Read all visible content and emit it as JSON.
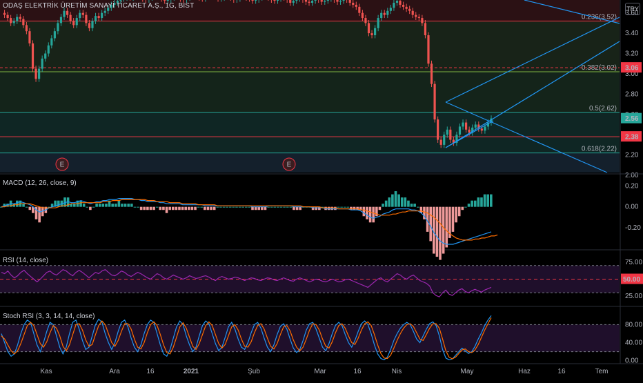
{
  "header": {
    "title": "ODAŞ ELEKTRİK ÜRETİM SANAYİ TİCARET A.Ş., 1G, BIST",
    "currency": "TRY"
  },
  "indicators": {
    "macd": "MACD (12, 26, close, 9)",
    "rsi": "RSI (14, close)",
    "stoch": "Stoch RSI (3, 3, 14, 14, close)"
  },
  "price_axis": {
    "ticks": [
      "3.60",
      "3.40",
      "3.20",
      "3.00",
      "2.80",
      "2.60",
      "2.40",
      "2.20",
      "2.00"
    ],
    "markers": [
      {
        "label": "3.06",
        "color": "#f23645"
      },
      {
        "label": "2.56",
        "color": "#26a69a"
      },
      {
        "label": "2.38",
        "color": "#f23645"
      }
    ]
  },
  "macd_axis": {
    "ticks": [
      "0.20",
      "0.00",
      "-0.20"
    ]
  },
  "rsi_axis": {
    "ticks": [
      "75.00",
      "25.00"
    ],
    "marker": "50.00"
  },
  "stoch_axis": {
    "ticks": [
      "80.00",
      "40.00",
      "0.00"
    ]
  },
  "time_axis": {
    "ticks": [
      "Kas",
      "Ara",
      "16",
      "2021",
      "Şub",
      "Mar",
      "16",
      "Nis",
      "May",
      "Haz",
      "16",
      "Tem"
    ]
  },
  "fib_levels": [
    {
      "label": "0.236(3.52)",
      "value": 3.52
    },
    {
      "label": "0.382(3.02)",
      "value": 3.02
    },
    {
      "label": "0.5(2.62)",
      "value": 2.62
    },
    {
      "label": "0.618(2.22)",
      "value": 2.22
    }
  ],
  "earnings": [
    "E",
    "E"
  ],
  "chart_data": {
    "type": "candlestick",
    "ylim": [
      2.0,
      3.7
    ],
    "horizontal_lines": [
      3.06,
      2.38
    ],
    "price_series": [
      3.6,
      3.58,
      3.55,
      3.5,
      3.52,
      3.56,
      3.54,
      3.48,
      3.42,
      3.3,
      3.05,
      2.95,
      3.05,
      3.15,
      3.2,
      3.28,
      3.35,
      3.42,
      3.5,
      3.56,
      3.62,
      3.58,
      3.52,
      3.48,
      3.55,
      3.6,
      3.58,
      3.5,
      3.45,
      3.52,
      3.57,
      3.55,
      3.6,
      3.62,
      3.65,
      3.68,
      3.7,
      3.72,
      3.74,
      3.75,
      3.76,
      3.75,
      3.77,
      3.78,
      3.76,
      3.74,
      3.73,
      3.75,
      3.77,
      3.78,
      3.76,
      3.74,
      3.72,
      3.73,
      3.75,
      3.77,
      3.76,
      3.74,
      3.73,
      3.75,
      3.76,
      3.78,
      3.77,
      3.75,
      3.74,
      3.76,
      3.77,
      3.78,
      3.76,
      3.74,
      3.75,
      3.77,
      3.76,
      3.75,
      3.73,
      3.74,
      3.76,
      3.77,
      3.75,
      3.74,
      3.72,
      3.73,
      3.75,
      3.76,
      3.77,
      3.75,
      3.73,
      3.72,
      3.74,
      3.76,
      3.75,
      3.73,
      3.7,
      3.72,
      3.74,
      3.75,
      3.73,
      3.71,
      3.7,
      3.72,
      3.74,
      3.73,
      3.71,
      3.72,
      3.74,
      3.75,
      3.73,
      3.71,
      3.72,
      3.74,
      3.73,
      3.7,
      3.68,
      3.66,
      3.6,
      3.55,
      3.5,
      3.4,
      3.38,
      3.45,
      3.55,
      3.6,
      3.58,
      3.62,
      3.65,
      3.7,
      3.72,
      3.68,
      3.66,
      3.64,
      3.62,
      3.58,
      3.56,
      3.55,
      3.5,
      3.38,
      3.1,
      2.9,
      2.55,
      2.35,
      2.3,
      2.4,
      2.45,
      2.35,
      2.32,
      2.4,
      2.48,
      2.52,
      2.45,
      2.42,
      2.47,
      2.5,
      2.46,
      2.44,
      2.48,
      2.52,
      2.56
    ],
    "macd_series": [
      0.0,
      0.01,
      0.02,
      0.03,
      0.03,
      0.04,
      0.05,
      0.04,
      0.03,
      0.02,
      0.0,
      -0.03,
      -0.05,
      -0.04,
      -0.03,
      -0.01,
      0.0,
      0.01,
      0.02,
      0.03,
      0.04,
      0.05,
      0.04,
      0.04,
      0.05,
      0.06,
      0.05,
      0.04,
      0.03,
      0.04,
      0.05,
      0.05,
      0.06,
      0.06,
      0.07,
      0.07,
      0.07,
      0.08,
      0.08,
      0.08,
      0.08,
      0.08,
      0.07,
      0.07,
      0.06,
      0.06,
      0.05,
      0.05,
      0.05,
      0.05,
      0.04,
      0.04,
      0.03,
      0.03,
      0.03,
      0.03,
      0.03,
      0.02,
      0.02,
      0.02,
      0.02,
      0.02,
      0.02,
      0.02,
      0.01,
      0.01,
      0.01,
      0.01,
      0.01,
      0.01,
      0.01,
      0.01,
      0.01,
      0.01,
      0.01,
      0.01,
      0.01,
      0.01,
      0.01,
      0.0,
      0.0,
      0.0,
      0.0,
      0.0,
      0.01,
      0.01,
      0.01,
      0.01,
      0.01,
      0.01,
      0.01,
      0.01,
      0.0,
      0.0,
      0.0,
      0.0,
      0.0,
      0.0,
      -0.01,
      -0.01,
      -0.01,
      -0.01,
      -0.02,
      -0.02,
      -0.02,
      -0.02,
      -0.02,
      -0.02,
      -0.02,
      -0.02,
      -0.03,
      -0.03,
      -0.03,
      -0.04,
      -0.06,
      -0.08,
      -0.1,
      -0.11,
      -0.1,
      -0.09,
      -0.07,
      -0.06,
      -0.05,
      -0.03,
      -0.02,
      -0.02,
      -0.02,
      -0.02,
      -0.02,
      -0.03,
      -0.03,
      -0.04,
      -0.06,
      -0.09,
      -0.14,
      -0.19,
      -0.25,
      -0.29,
      -0.33,
      -0.35,
      -0.36,
      -0.36,
      -0.36,
      -0.35,
      -0.34,
      -0.33,
      -0.32,
      -0.31,
      -0.3,
      -0.29,
      -0.28,
      -0.27,
      -0.26,
      -0.25,
      -0.24
    ],
    "signal_series": [
      0.0,
      0.0,
      0.01,
      0.01,
      0.02,
      0.02,
      0.03,
      0.03,
      0.03,
      0.03,
      0.02,
      0.01,
      0.0,
      -0.01,
      -0.01,
      -0.01,
      -0.01,
      -0.01,
      0.0,
      0.01,
      0.01,
      0.02,
      0.03,
      0.03,
      0.03,
      0.04,
      0.04,
      0.04,
      0.04,
      0.04,
      0.04,
      0.04,
      0.05,
      0.05,
      0.05,
      0.06,
      0.06,
      0.06,
      0.07,
      0.07,
      0.07,
      0.07,
      0.07,
      0.07,
      0.07,
      0.07,
      0.06,
      0.06,
      0.06,
      0.05,
      0.05,
      0.05,
      0.05,
      0.04,
      0.04,
      0.04,
      0.04,
      0.03,
      0.03,
      0.03,
      0.03,
      0.03,
      0.02,
      0.02,
      0.02,
      0.02,
      0.02,
      0.02,
      0.01,
      0.01,
      0.01,
      0.01,
      0.01,
      0.01,
      0.01,
      0.01,
      0.01,
      0.01,
      0.01,
      0.01,
      0.01,
      0.01,
      0.01,
      0.01,
      0.01,
      0.01,
      0.01,
      0.01,
      0.01,
      0.01,
      0.01,
      0.01,
      0.01,
      0.01,
      0.01,
      0.0,
      0.0,
      0.0,
      0.0,
      0.0,
      0.0,
      -0.01,
      -0.01,
      -0.01,
      -0.01,
      -0.01,
      -0.02,
      -0.02,
      -0.02,
      -0.02,
      -0.02,
      -0.02,
      -0.02,
      -0.03,
      -0.03,
      -0.04,
      -0.05,
      -0.06,
      -0.07,
      -0.08,
      -0.08,
      -0.08,
      -0.08,
      -0.07,
      -0.07,
      -0.06,
      -0.05,
      -0.05,
      -0.04,
      -0.04,
      -0.04,
      -0.04,
      -0.04,
      -0.05,
      -0.06,
      -0.08,
      -0.1,
      -0.13,
      -0.16,
      -0.2,
      -0.23,
      -0.26,
      -0.28,
      -0.3,
      -0.31,
      -0.32,
      -0.32,
      -0.32,
      -0.32,
      -0.31,
      -0.31,
      -0.3,
      -0.3,
      -0.29,
      -0.28,
      -0.28,
      -0.27
    ],
    "rsi_series": [
      60,
      58,
      62,
      56,
      52,
      55,
      60,
      63,
      58,
      54,
      50,
      46,
      50,
      55,
      60,
      62,
      58,
      56,
      60,
      64,
      62,
      58,
      55,
      60,
      63,
      60,
      56,
      52,
      56,
      60,
      58,
      62,
      64,
      60,
      56,
      55,
      58,
      62,
      60,
      56,
      54,
      57,
      60,
      58,
      55,
      52,
      50,
      54,
      58,
      56,
      52,
      50,
      53,
      56,
      54,
      52,
      50,
      52,
      55,
      53,
      51,
      52,
      54,
      55,
      53,
      50,
      48,
      52,
      54,
      52,
      50,
      51,
      53,
      52,
      50,
      48,
      50,
      52,
      51,
      49,
      48,
      50,
      52,
      51,
      49,
      48,
      50,
      52,
      50,
      48,
      47,
      50,
      52,
      50,
      48,
      46,
      48,
      50,
      49,
      47,
      46,
      48,
      50,
      48,
      46,
      47,
      49,
      50,
      48,
      46,
      44,
      42,
      40,
      38,
      42,
      46,
      50,
      52,
      48,
      46,
      50,
      54,
      58,
      56,
      52,
      50,
      54,
      56,
      52,
      48,
      46,
      44,
      40,
      30,
      26,
      24,
      30,
      34,
      28,
      26,
      30,
      34,
      36,
      32,
      30,
      33,
      35,
      33,
      31,
      34,
      36,
      38
    ],
    "stoch_k_series": [
      60,
      40,
      20,
      10,
      15,
      35,
      60,
      80,
      90,
      85,
      60,
      35,
      20,
      40,
      65,
      85,
      80,
      55,
      30,
      15,
      30,
      60,
      85,
      90,
      70,
      45,
      25,
      30,
      55,
      80,
      92,
      85,
      60,
      40,
      25,
      40,
      65,
      85,
      90,
      75,
      50,
      30,
      20,
      35,
      60,
      80,
      90,
      85,
      60,
      35,
      15,
      10,
      25,
      50,
      75,
      88,
      80,
      55,
      35,
      20,
      30,
      55,
      78,
      88,
      82,
      60,
      38,
      22,
      30,
      52,
      75,
      85,
      70,
      48,
      30,
      25,
      40,
      62,
      80,
      85,
      72,
      50,
      30,
      20,
      35,
      58,
      76,
      82,
      70,
      48,
      28,
      18,
      25,
      45,
      68,
      82,
      85,
      70,
      50,
      30,
      22,
      38,
      60,
      78,
      85,
      78,
      58,
      40,
      30,
      45,
      65,
      82,
      88,
      80,
      60,
      35,
      15,
      5,
      2,
      8,
      25,
      45,
      60,
      72,
      80,
      85,
      80,
      65,
      48,
      40,
      55,
      70,
      82,
      86,
      78,
      55,
      25,
      6,
      2,
      4,
      12,
      20,
      28,
      22,
      16,
      20,
      32,
      48,
      62,
      78,
      90,
      100
    ],
    "stoch_d_series": [
      55,
      48,
      35,
      22,
      15,
      22,
      38,
      58,
      78,
      85,
      78,
      58,
      38,
      30,
      42,
      62,
      78,
      72,
      55,
      32,
      22,
      35,
      58,
      80,
      82,
      68,
      46,
      32,
      36,
      58,
      78,
      88,
      80,
      60,
      40,
      32,
      45,
      65,
      82,
      82,
      70,
      48,
      30,
      26,
      40,
      62,
      80,
      86,
      78,
      58,
      35,
      18,
      15,
      30,
      52,
      75,
      84,
      72,
      52,
      32,
      25,
      38,
      58,
      78,
      86,
      78,
      58,
      38,
      28,
      36,
      55,
      75,
      80,
      68,
      48,
      32,
      30,
      42,
      62,
      78,
      82,
      70,
      50,
      32,
      26,
      38,
      58,
      75,
      78,
      66,
      46,
      30,
      22,
      30,
      48,
      68,
      82,
      80,
      68,
      48,
      32,
      28,
      42,
      62,
      78,
      82,
      72,
      55,
      40,
      36,
      50,
      68,
      82,
      86,
      78,
      58,
      35,
      16,
      6,
      5,
      12,
      28,
      45,
      60,
      72,
      80,
      82,
      76,
      62,
      48,
      45,
      58,
      72,
      82,
      82,
      72,
      48,
      22,
      8,
      4,
      8,
      16,
      24,
      26,
      20,
      18,
      24,
      36,
      52,
      68,
      82,
      95
    ]
  }
}
